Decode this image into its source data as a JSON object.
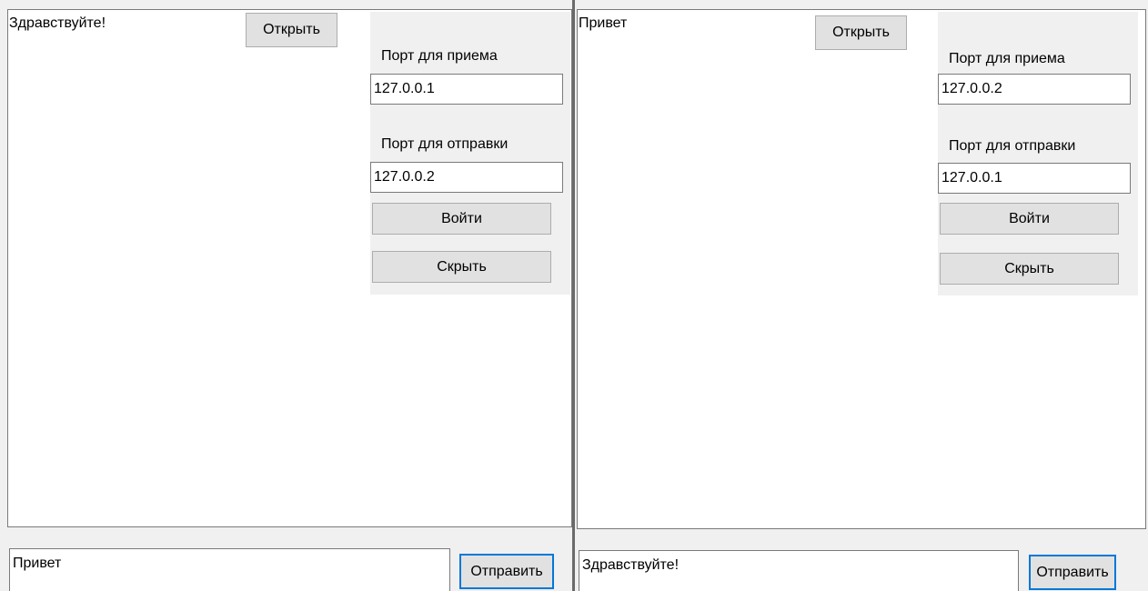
{
  "left_window": {
    "chat_log": "Здравствуйте!",
    "open_label": "Открыть",
    "receive_port_label": "Порт для приема",
    "receive_port_value": "127.0.0.1",
    "send_port_label": "Порт для отправки",
    "send_port_value": "127.0.0.2",
    "login_label": "Войти",
    "hide_label": "Скрыть",
    "message_value": "Привет",
    "send_label": "Отправить"
  },
  "right_window": {
    "chat_log": "Привет",
    "open_label": "Открыть",
    "receive_port_label": "Порт для приема",
    "receive_port_value": "127.0.0.2",
    "send_port_label": "Порт для отправки",
    "send_port_value": "127.0.0.1",
    "login_label": "Войти",
    "hide_label": "Скрыть",
    "message_value": "Здравствуйте!",
    "send_label": "Отправить"
  },
  "colors": {
    "window_bg": "#f0f0f0",
    "button_bg": "#e1e1e1",
    "focus_border": "#0078d7",
    "field_border": "#7a7a7a"
  }
}
